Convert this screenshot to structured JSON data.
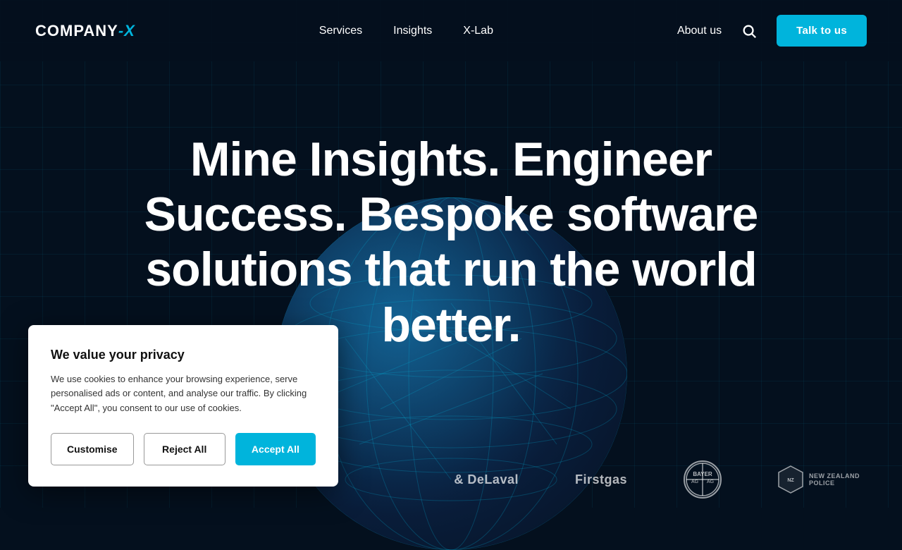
{
  "brand": {
    "name_part1": "COMPANY",
    "name_part2": "-X",
    "logo_alt": "Company-X logo"
  },
  "nav": {
    "links": [
      {
        "id": "services",
        "label": "Services"
      },
      {
        "id": "insights",
        "label": "Insights"
      },
      {
        "id": "xlab",
        "label": "X-Lab"
      }
    ],
    "about_label": "About us",
    "search_label": "Search",
    "cta_label": "Talk to us"
  },
  "hero": {
    "title": "Mine Insights. Engineer Success. Bespoke software solutions that run the world better."
  },
  "client_logos": [
    {
      "id": "delaval",
      "text": "& DeLaval"
    },
    {
      "id": "firstgas",
      "text": "Firstgas"
    },
    {
      "id": "bayer",
      "text": "BAYER"
    },
    {
      "id": "nzpolice",
      "text": "NEW ZEALAND POLICE"
    }
  ],
  "cookie": {
    "title": "We value your privacy",
    "body": "We use cookies to enhance your browsing experience, serve personalised ads or content, and analyse our traffic. By clicking \"Accept All\", you consent to our use of cookies.",
    "btn_customise": "Customise",
    "btn_reject": "Reject All",
    "btn_accept": "Accept All"
  },
  "colors": {
    "accent": "#00b4dc",
    "bg_dark": "#04101e"
  }
}
